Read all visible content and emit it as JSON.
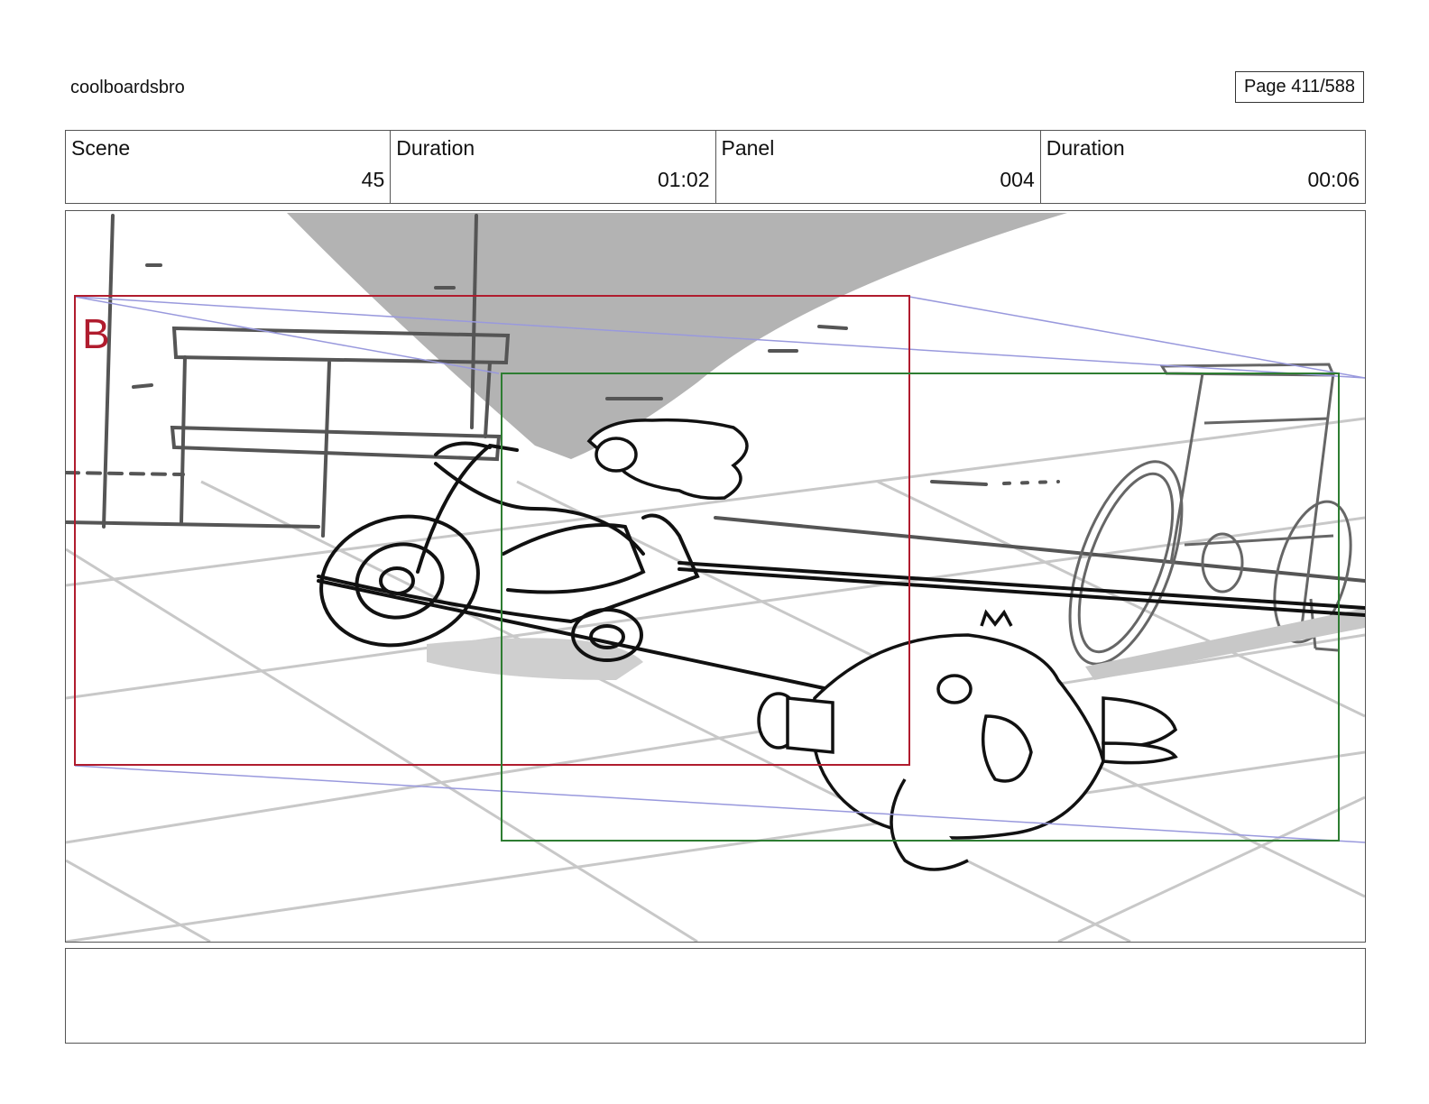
{
  "header": {
    "studio": "coolboardsbro",
    "page": "Page 411/588"
  },
  "info": [
    {
      "label": "Scene",
      "value": "45"
    },
    {
      "label": "Duration",
      "value": "01:02"
    },
    {
      "label": "Panel",
      "value": "004"
    },
    {
      "label": "Duration",
      "value": "00:06"
    }
  ],
  "frame": {
    "camera_label": "B",
    "colors": {
      "camera_b": "#b01c2e",
      "camera_a": "#2e7d32",
      "shadow": "#b3b3b3",
      "guide": "#9999dd"
    }
  },
  "notes": {
    "text": ""
  }
}
